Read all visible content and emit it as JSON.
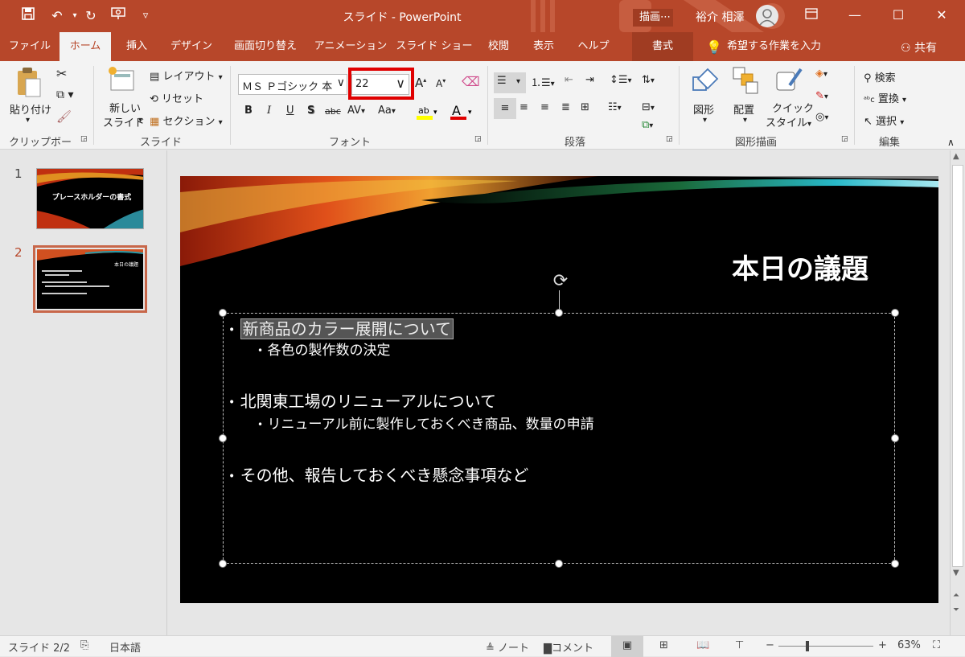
{
  "titlebar": {
    "title": "スライド  -  PowerPoint",
    "context_tab": "描画⋯",
    "user_name": "裕介 相澤",
    "qat_customize": "▿"
  },
  "tabs": [
    "ファイル",
    "ホーム",
    "挿入",
    "デザイン",
    "画面切り替え",
    "アニメーション",
    "スライド ショー",
    "校閲",
    "表示",
    "ヘルプ"
  ],
  "context_tab_label": "書式",
  "tell_me": "希望する作業を入力",
  "share": "共有",
  "ribbon": {
    "clipboard": {
      "paste": "貼り付け",
      "label": "クリップボード"
    },
    "slides": {
      "new_slide_1": "新しい",
      "new_slide_2": "スライド",
      "layout": "レイアウト",
      "reset": "リセット",
      "section": "セクション",
      "label": "スライド"
    },
    "font": {
      "name": "ＭＳ Ｐゴシック 本文",
      "size": "22",
      "bold": "B",
      "italic": "I",
      "underline": "U",
      "shadow": "S",
      "strike": "abc",
      "spacing": "AV",
      "case": "Aa",
      "grow": "A",
      "shrink": "A",
      "label": "フォント"
    },
    "paragraph": {
      "label": "段落"
    },
    "drawing": {
      "shape": "図形",
      "arrange": "配置",
      "quick_1": "クイック",
      "quick_2": "スタイル",
      "label": "図形描画"
    },
    "editing": {
      "find": "検索",
      "replace": "置換",
      "select": "選択",
      "label": "編集"
    }
  },
  "thumbnails": [
    {
      "num": "1",
      "title": "プレースホルダーの書式"
    },
    {
      "num": "2",
      "title": "本日の議題"
    }
  ],
  "slide": {
    "title": "本日の議題",
    "bullets": [
      {
        "level": 1,
        "text": "新商品のカラー展開について",
        "selected": true
      },
      {
        "level": 2,
        "text": "各色の製作数の決定"
      },
      {
        "level": 1,
        "text": "北関東工場のリニューアルについて"
      },
      {
        "level": 2,
        "text": "リニューアル前に製作しておくべき商品、数量の申請"
      },
      {
        "level": 1,
        "text": "その他、報告しておくべき懸念事項など"
      }
    ]
  },
  "status": {
    "slide": "スライド 2/2",
    "lang": "日本語",
    "notes": "ノート",
    "comments": "コメント",
    "zoom_minus": "−",
    "zoom_plus": "+",
    "zoom": "63%"
  },
  "colors": {
    "brand": "#b7472a",
    "highlight": "#e00000"
  }
}
